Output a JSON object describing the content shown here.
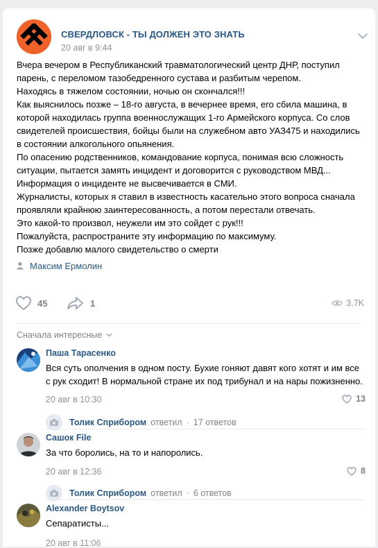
{
  "post": {
    "group_name": "СВЕРДЛОВСК - ТЫ ДОЛЖЕН ЭТО ЗНАТЬ",
    "date": "20 авг в 9:44",
    "lines": [
      "Вчера вечером в Республиканский травматологический центр ДНР, поступил",
      "парень, с переломом тазобедренного сустава и разбитым черепом.",
      "Находясь в тяжелом состоянии, ночью он скончался!!!",
      "Как выяснилось позже – 18-го августа, в вечернее время, его сбила машина, в",
      "которой находилась группа военнослужащих 1-го Армейского корпуса. Со слов",
      "свидетелей происшествия, бойцы были на служебном авто УАЗ475 и находились",
      "в состоянии алкогольного опьянения.",
      "По опасению родственников, командование корпуса, понимая всю сложность",
      "ситуации, пытается замять инцидент и договорится с руководством МВД...",
      "Информация о инциденте не высвечивается в СМИ.",
      "Журналисты, которых я ставил в известность касательно этого вопроса сначала",
      "проявляли крайнюю заинтересованность, а потом перестали отвечать.",
      "Это какой-то произвол, неужели им это сойдет с рук!!!",
      "Пожалуйста, распространите эту информацию по максимуму.",
      "Позже добавлю малого свидетельство о смерти"
    ],
    "signer": "Максим Ермолин",
    "likes": "45",
    "shares": "1",
    "views": "3.7K",
    "accent": "#2a5885",
    "avatar_color": "#f0622a"
  },
  "comments_sort": "Сначала интересные",
  "comments": [
    {
      "author": "Паша Тарасенко",
      "lines": [
        "Вся суть ополчения в одном посту. Бухие гоняют давят кого хотят и им все",
        "с рук сходит! В нормальной стране их под трибунал и на нары пожизненно."
      ],
      "date": "20 авг в 10:30",
      "likes": "13",
      "reply_author": "Толик Сприбором",
      "reply_verb": "ответил",
      "reply_count": "17 ответов"
    },
    {
      "author": "Сашок File",
      "lines": [
        "За что боролись, на то и напоролись."
      ],
      "date": "20 авг в 12:36",
      "likes": "8",
      "reply_author": "Толик Сприбором",
      "reply_verb": "ответил",
      "reply_count": "6 ответов"
    },
    {
      "author": "Alexander Boytsov",
      "lines": [
        "Сепаратисты..."
      ],
      "date": "20 авг в 11:06"
    }
  ]
}
